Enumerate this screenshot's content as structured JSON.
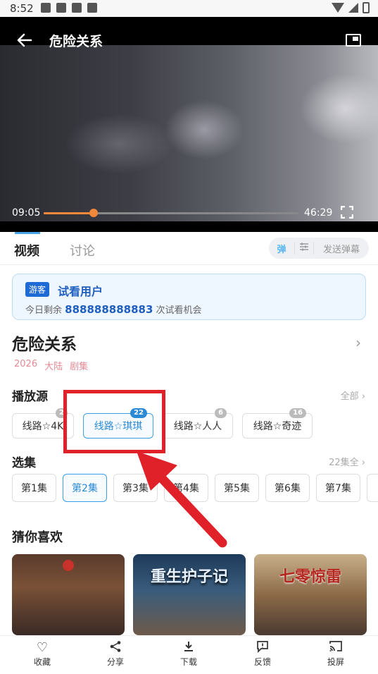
{
  "status_bar": {
    "time": "8:52"
  },
  "player": {
    "title": "危险关系",
    "current_time": "09:05",
    "duration": "46:29",
    "progress": 0.196
  },
  "tabs": {
    "video": "视频",
    "discuss": "讨论"
  },
  "danmu": {
    "toggle": "弹",
    "settings_icon": "sliders-icon",
    "send": "发送弹幕"
  },
  "guest": {
    "badge": "游客",
    "title": "试看用户",
    "prefix": "今日剩余",
    "count": "888888888883",
    "suffix": "次试看机会"
  },
  "show": {
    "title": "危险关系",
    "year": "2026",
    "region": "大陆",
    "type": "剧集"
  },
  "sources": {
    "title": "播放源",
    "more": "全部",
    "items": [
      {
        "label": "线路☆4K",
        "count": "2"
      },
      {
        "label": "线路☆琪琪",
        "count": "22"
      },
      {
        "label": "线路☆人人",
        "count": "6"
      },
      {
        "label": "线路☆奇迹",
        "count": "16"
      }
    ]
  },
  "episodes": {
    "title": "选集",
    "more": "22集全",
    "items": [
      "第1集",
      "第2集",
      "第3集",
      "第4集",
      "第5集",
      "第6集",
      "第7集"
    ]
  },
  "recommend": {
    "title": "猜你喜欢",
    "items": [
      {
        "poster_text": ""
      },
      {
        "poster_text": "重生护子记"
      },
      {
        "poster_text": "七零惊雷"
      }
    ]
  },
  "bottom_bar": {
    "favorite": "收藏",
    "share": "分享",
    "download": "下载",
    "feedback": "反馈",
    "cast": "投屏"
  },
  "colors": {
    "accent": "#2b8ad6",
    "progress": "#f2883a",
    "annotation": "#e0212a"
  }
}
